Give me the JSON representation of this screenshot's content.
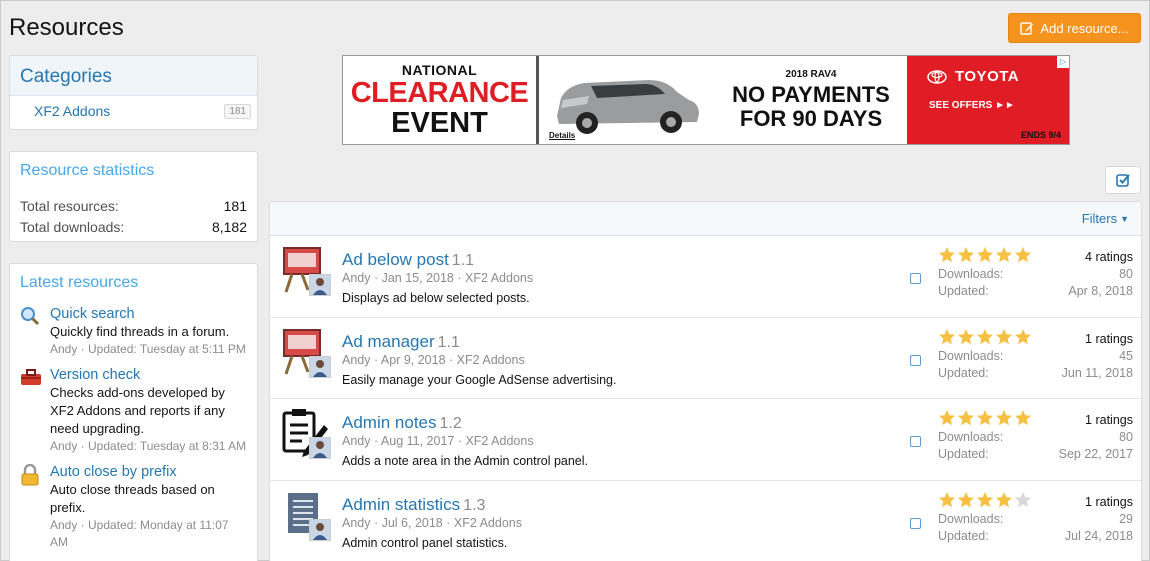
{
  "page": {
    "title": "Resources",
    "add_button": "Add resource..."
  },
  "categories": {
    "title": "Categories",
    "items": [
      {
        "label": "XF2 Addons",
        "count": "181"
      }
    ]
  },
  "stats": {
    "title": "Resource statistics",
    "rows": [
      {
        "label": "Total resources:",
        "value": "181"
      },
      {
        "label": "Total downloads:",
        "value": "8,182"
      }
    ]
  },
  "latest": {
    "title": "Latest resources",
    "items": [
      {
        "icon": "magnifier-icon",
        "title": "Quick search",
        "desc": "Quickly find threads in a forum.",
        "meta": "Andy · Updated: Tuesday at 5:11 PM"
      },
      {
        "icon": "toolbox-icon",
        "title": "Version check",
        "desc": "Checks add-ons developed by XF2 Addons and reports if any need upgrading.",
        "meta": "Andy · Updated: Tuesday at 8:31 AM"
      },
      {
        "icon": "lock-icon",
        "title": "Auto close by prefix",
        "desc": "Auto close threads based on prefix.",
        "meta": "Andy · Updated: Monday at 11:07 AM"
      }
    ]
  },
  "ad": {
    "national": "NATIONAL",
    "clearance": "CLEARANCE",
    "event": "EVENT",
    "details": "Details",
    "model": "2018 RAV4",
    "headline_1": "NO PAYMENTS",
    "headline_2": "FOR 90 DAYS",
    "brand": "TOYOTA",
    "offers": "SEE OFFERS ►►",
    "ends": "ENDS 9/4",
    "colors": {
      "red": "#e01d24"
    }
  },
  "list": {
    "filters_label": "Filters",
    "labels": {
      "downloads": "Downloads:",
      "updated": "Updated:"
    },
    "rows": [
      {
        "icon": "ad-sign-icon",
        "title": "Ad below post",
        "version": "1.1",
        "meta": "Andy · Jan 15, 2018 · XF2 Addons",
        "desc": "Displays ad below selected posts.",
        "rating": 5,
        "ratings": "4 ratings",
        "downloads": "80",
        "updated": "Apr 8, 2018"
      },
      {
        "icon": "ad-sign-icon",
        "title": "Ad manager",
        "version": "1.1",
        "meta": "Andy · Apr 9, 2018 · XF2 Addons",
        "desc": "Easily manage your Google AdSense advertising.",
        "rating": 5,
        "ratings": "1 ratings",
        "downloads": "45",
        "updated": "Jun 11, 2018"
      },
      {
        "icon": "clipboard-pen-icon",
        "title": "Admin notes",
        "version": "1.2",
        "meta": "Andy · Aug 11, 2017 · XF2 Addons",
        "desc": "Adds a note area in the Admin control panel.",
        "rating": 5,
        "ratings": "1 ratings",
        "downloads": "80",
        "updated": "Sep 22, 2017"
      },
      {
        "icon": "document-icon",
        "title": "Admin statistics",
        "version": "1.3",
        "meta": "Andy · Jul 6, 2018 · XF2 Addons",
        "desc": "Admin control panel statistics.",
        "rating": 4,
        "ratings": "1 ratings",
        "downloads": "29",
        "updated": "Jul 24, 2018"
      }
    ]
  },
  "colors": {
    "link": "#2577b1",
    "accent": "#f6921e",
    "star": "#f6c043",
    "star_empty": "#d8d8d8"
  }
}
